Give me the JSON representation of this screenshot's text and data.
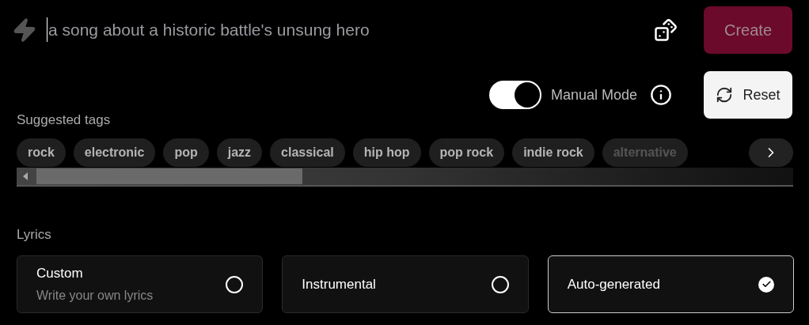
{
  "prompt": {
    "placeholder": "a song about a historic battle's unsung hero"
  },
  "create_button": {
    "label": "Create",
    "disabled": true
  },
  "manual_mode": {
    "label": "Manual Mode",
    "on": true
  },
  "reset_button": {
    "label": "Reset"
  },
  "suggested_tags": {
    "title": "Suggested tags",
    "tags": [
      "rock",
      "electronic",
      "pop",
      "jazz",
      "classical",
      "hip hop",
      "pop rock",
      "indie rock",
      "alternative"
    ]
  },
  "lyrics": {
    "title": "Lyrics",
    "options": [
      {
        "label": "Custom",
        "description": "Write your own lyrics",
        "selected": false
      },
      {
        "label": "Instrumental",
        "selected": false
      },
      {
        "label": "Auto-generated",
        "selected": true
      }
    ]
  }
}
